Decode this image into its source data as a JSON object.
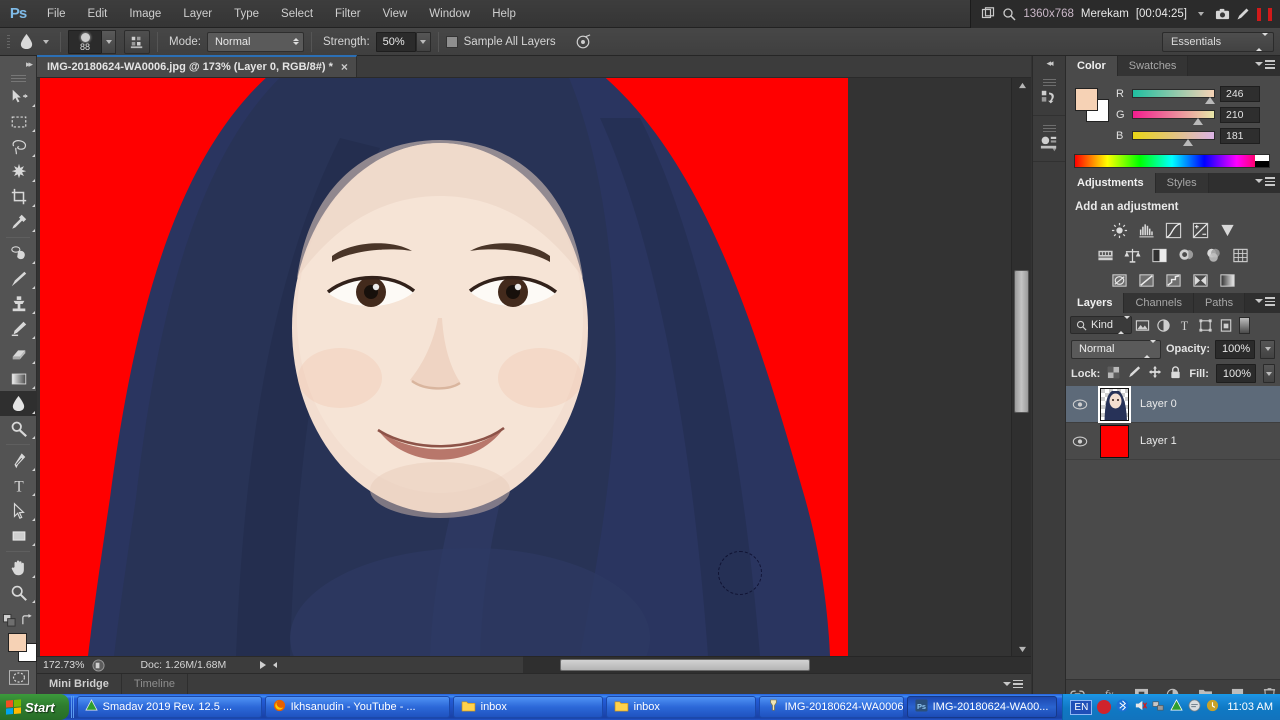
{
  "app": {
    "name": "Ps",
    "title": "Adobe Photoshop"
  },
  "menubar": {
    "items": [
      "File",
      "Edit",
      "Image",
      "Layer",
      "Type",
      "Select",
      "Filter",
      "View",
      "Window",
      "Help"
    ]
  },
  "recorder": {
    "resolution": "1360x768",
    "status_label": "Merekam",
    "timer": "[00:04:25]",
    "icons": [
      "window-icon",
      "magnifier-icon",
      "chevron-down-icon",
      "camera-icon",
      "pencil-icon",
      "pause-icon"
    ]
  },
  "options_bar": {
    "tool_icon": "smudge-tool-icon",
    "brush_size": "88",
    "brush_panel_icon": "brush-panel-icon",
    "mode_label": "Mode:",
    "mode_value": "Normal",
    "strength_label": "Strength:",
    "strength_value": "50%",
    "sample_all_layers_label": "Sample All Layers",
    "sample_all_layers_checked": false,
    "pressure_icon": "tablet-pressure-icon",
    "workspace": "Essentials"
  },
  "toolbar": {
    "tools": [
      {
        "name": "move-tool",
        "active": false
      },
      {
        "name": "rectangular-marquee-tool",
        "active": false
      },
      {
        "name": "lasso-tool",
        "active": false
      },
      {
        "name": "magic-wand-tool",
        "active": false
      },
      {
        "name": "crop-tool",
        "active": false
      },
      {
        "name": "eyedropper-tool",
        "active": false
      },
      {
        "name": "healing-brush-tool",
        "active": false
      },
      {
        "name": "brush-tool",
        "active": false
      },
      {
        "name": "clone-stamp-tool",
        "active": false
      },
      {
        "name": "history-brush-tool",
        "active": false
      },
      {
        "name": "eraser-tool",
        "active": false
      },
      {
        "name": "gradient-tool",
        "active": false
      },
      {
        "name": "blur-smudge-tool",
        "active": true
      },
      {
        "name": "dodge-tool",
        "active": false
      },
      {
        "name": "pen-tool",
        "active": false
      },
      {
        "name": "type-tool",
        "active": false
      },
      {
        "name": "path-selection-tool",
        "active": false
      },
      {
        "name": "rectangle-shape-tool",
        "active": false
      },
      {
        "name": "hand-tool",
        "active": false
      },
      {
        "name": "zoom-tool",
        "active": false
      }
    ],
    "foreground_color": "#f6d2b5",
    "background_color": "#ffffff"
  },
  "document": {
    "tab_title": "IMG-20180624-WA0006.jpg @ 173% (Layer 0, RGB/8#) *",
    "close_label": "×",
    "canvas_background": "#ff0000",
    "subject": "woman wearing navy blue hijab on red background"
  },
  "status_bar": {
    "zoom": "172.73%",
    "doc_info": "Doc: 1.26M/1.68M"
  },
  "bottom_dock": {
    "tabs": [
      {
        "label": "Mini Bridge",
        "active": true
      },
      {
        "label": "Timeline",
        "active": false
      }
    ]
  },
  "mini_dock": {
    "items": [
      "history-panel-icon",
      "mini-bridge-panel-icon"
    ]
  },
  "color_panel": {
    "tabs": [
      {
        "label": "Color",
        "active": true
      },
      {
        "label": "Swatches",
        "active": false
      }
    ],
    "channels": [
      {
        "label": "R",
        "value": "246",
        "pos": 0.96
      },
      {
        "label": "G",
        "value": "210",
        "pos": 0.82
      },
      {
        "label": "B",
        "value": "181",
        "pos": 0.71
      }
    ],
    "foreground": "#f6d2b5",
    "background": "#ffffff"
  },
  "adjustments_panel": {
    "tabs": [
      {
        "label": "Adjustments",
        "active": true
      },
      {
        "label": "Styles",
        "active": false
      }
    ],
    "heading": "Add an adjustment",
    "rows": [
      [
        "brightness-contrast-icon",
        "levels-icon",
        "curves-icon",
        "exposure-icon",
        "vibrance-icon"
      ],
      [
        "hue-saturation-icon",
        "color-balance-icon",
        "black-white-icon",
        "photo-filter-icon",
        "channel-mixer-icon",
        "color-lookup-icon"
      ],
      [
        "invert-icon",
        "posterize-icon",
        "threshold-icon",
        "selective-color-icon",
        "gradient-map-icon"
      ]
    ]
  },
  "layers_panel": {
    "tabs": [
      {
        "label": "Layers",
        "active": true
      },
      {
        "label": "Channels",
        "active": false
      },
      {
        "label": "Paths",
        "active": false
      }
    ],
    "filter_label": "Kind",
    "filter_icons": [
      "pixel-filter-icon",
      "adjustment-filter-icon",
      "type-filter-icon",
      "shape-filter-icon",
      "smart-object-filter-icon"
    ],
    "blend_mode": "Normal",
    "opacity_label": "Opacity:",
    "opacity_value": "100%",
    "lock_label": "Lock:",
    "lock_icons": [
      "lock-transparent-icon",
      "lock-image-icon",
      "lock-position-icon",
      "lock-all-icon"
    ],
    "fill_label": "Fill:",
    "fill_value": "100%",
    "layers": [
      {
        "name": "Layer 0",
        "visible": true,
        "selected": true,
        "thumb_type": "portrait"
      },
      {
        "name": "Layer 1",
        "visible": true,
        "selected": false,
        "thumb_type": "solid",
        "thumb_color": "#ff0000"
      }
    ],
    "footer_icons": [
      "link-layers-icon",
      "layer-style-icon",
      "layer-mask-icon",
      "new-adjustment-icon",
      "new-group-icon",
      "new-layer-icon",
      "delete-layer-icon"
    ]
  },
  "taskbar": {
    "start_label": "Start",
    "buttons": [
      {
        "label": "Smadav 2019 Rev. 12.5 ...",
        "icon": "smadav-icon",
        "active": false
      },
      {
        "label": "Ikhsanudin - YouTube - ...",
        "icon": "firefox-icon",
        "active": false
      },
      {
        "label": "inbox",
        "icon": "folder-icon",
        "active": false
      },
      {
        "label": "inbox",
        "icon": "folder-icon",
        "active": false
      },
      {
        "label": "IMG-20180624-WA0006....",
        "icon": "image-viewer-icon",
        "active": false
      },
      {
        "label": "IMG-20180624-WA00...",
        "icon": "photoshop-icon",
        "active": true
      }
    ],
    "language": "EN",
    "tray_icons": [
      "record-icon",
      "bluetooth-icon",
      "volume-icon",
      "network-icon",
      "smadav-tray-icon",
      "messenger-icon",
      "update-icon"
    ],
    "clock": "11:03 AM"
  }
}
